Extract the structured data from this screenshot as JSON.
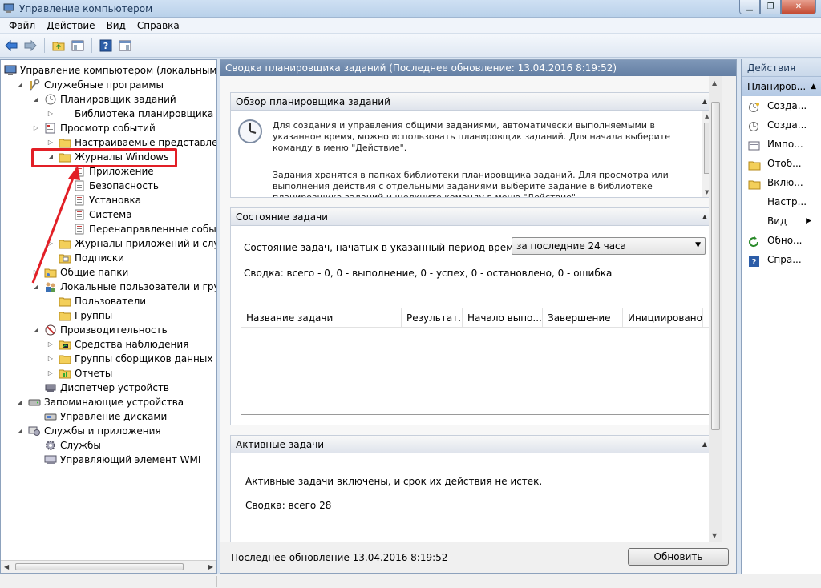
{
  "window": {
    "title": "Управление компьютером"
  },
  "menu": [
    "Файл",
    "Действие",
    "Вид",
    "Справка"
  ],
  "tree": [
    {
      "label": "Управление компьютером (локальным)",
      "level": 0,
      "toggle": "",
      "icon": "computer-icon"
    },
    {
      "label": "Служебные программы",
      "level": 1,
      "toggle": "open",
      "icon": "tools-icon"
    },
    {
      "label": "Планировщик заданий",
      "level": 2,
      "toggle": "open",
      "icon": "clock-icon"
    },
    {
      "label": "Библиотека планировщика задан",
      "level": 3,
      "toggle": "closed",
      "icon": "none"
    },
    {
      "label": "Просмотр событий",
      "level": 2,
      "toggle": "closed",
      "icon": "event-viewer-icon"
    },
    {
      "label": "Настраиваемые представления",
      "level": 3,
      "toggle": "closed",
      "icon": "folder-icon"
    },
    {
      "label": "Журналы Windows",
      "level": 3,
      "toggle": "open",
      "icon": "folder-icon"
    },
    {
      "label": "Приложение",
      "level": 4,
      "toggle": "",
      "icon": "log-icon"
    },
    {
      "label": "Безопасность",
      "level": 4,
      "toggle": "",
      "icon": "log-icon"
    },
    {
      "label": "Установка",
      "level": 4,
      "toggle": "",
      "icon": "log-icon"
    },
    {
      "label": "Система",
      "level": 4,
      "toggle": "",
      "icon": "log-icon"
    },
    {
      "label": "Перенаправленные события",
      "level": 4,
      "toggle": "",
      "icon": "log-icon"
    },
    {
      "label": "Журналы приложений и служб",
      "level": 3,
      "toggle": "closed",
      "icon": "folder-icon"
    },
    {
      "label": "Подписки",
      "level": 3,
      "toggle": "",
      "icon": "subscription-icon"
    },
    {
      "label": "Общие папки",
      "level": 2,
      "toggle": "closed",
      "icon": "shared-folder-icon"
    },
    {
      "label": "Локальные пользователи и группы",
      "level": 2,
      "toggle": "open",
      "icon": "users-icon"
    },
    {
      "label": "Пользователи",
      "level": 3,
      "toggle": "",
      "icon": "folder-icon"
    },
    {
      "label": "Группы",
      "level": 3,
      "toggle": "",
      "icon": "folder-icon"
    },
    {
      "label": "Производительность",
      "level": 2,
      "toggle": "open",
      "icon": "performance-icon"
    },
    {
      "label": "Средства наблюдения",
      "level": 3,
      "toggle": "closed",
      "icon": "monitor-folder-icon"
    },
    {
      "label": "Группы сборщиков данных",
      "level": 3,
      "toggle": "closed",
      "icon": "folder-icon"
    },
    {
      "label": "Отчеты",
      "level": 3,
      "toggle": "closed",
      "icon": "report-folder-icon"
    },
    {
      "label": "Диспетчер устройств",
      "level": 2,
      "toggle": "",
      "icon": "device-manager-icon"
    },
    {
      "label": "Запоминающие устройства",
      "level": 1,
      "toggle": "open",
      "icon": "storage-icon"
    },
    {
      "label": "Управление дисками",
      "level": 2,
      "toggle": "",
      "icon": "disk-icon"
    },
    {
      "label": "Службы и приложения",
      "level": 1,
      "toggle": "open",
      "icon": "services-apps-icon"
    },
    {
      "label": "Службы",
      "level": 2,
      "toggle": "",
      "icon": "gear-icon"
    },
    {
      "label": "Управляющий элемент WMI",
      "level": 2,
      "toggle": "",
      "icon": "wmi-icon"
    }
  ],
  "center": {
    "header": "Сводка планировщика заданий (Последнее обновление: 13.04.2016 8:19:52)",
    "overview": {
      "title": "Обзор планировщика заданий",
      "p1": "Для создания и управления общими заданиями, автоматически выполняемыми в указанное время, можно использовать планировщик заданий. Для начала выберите команду в меню \"Действие\".",
      "p2": "Задания хранятся в папках библиотеки планировщика заданий. Для просмотра или выполнения действия с отдельными заданиями выберите задание в библиотеке планировщика заданий и щелкните команду в меню \"Действие\"."
    },
    "status": {
      "title": "Состояние задачи",
      "period_label": "Состояние задач, начатых в указанный период времени:",
      "period_value": "за последние 24 часа",
      "summary": "Сводка: всего - 0, 0 - выполнение, 0 - успех, 0 - остановлено, 0 - ошибка",
      "columns": [
        "Название задачи",
        "Результат...",
        "Начало выпо...",
        "Завершение в...",
        "Инициировано"
      ]
    },
    "active": {
      "title": "Активные задачи",
      "text": "Активные задачи включены, и срок их действия не истек.",
      "summary": "Сводка: всего 28"
    },
    "footer": {
      "text": "Последнее обновление 13.04.2016 8:19:52",
      "refresh": "Обновить"
    }
  },
  "actions": {
    "title": "Действия",
    "subheader": "Планиров...",
    "items": [
      {
        "label": "Созда...",
        "icon": "create-basic-task-icon"
      },
      {
        "label": "Созда...",
        "icon": "create-task-icon"
      },
      {
        "label": "Импо...",
        "icon": "import-icon"
      },
      {
        "label": "Отоб...",
        "icon": "folder-icon"
      },
      {
        "label": "Вклю...",
        "icon": "folder-icon"
      },
      {
        "label": "Настр...",
        "icon": "none"
      },
      {
        "label": "Вид",
        "icon": "none",
        "submenu": true
      },
      {
        "label": "Обно...",
        "icon": "refresh-icon"
      },
      {
        "label": "Спра...",
        "icon": "help-icon"
      }
    ]
  },
  "colors": {
    "highlight": "#e21f26",
    "header": "#7e97b8"
  }
}
